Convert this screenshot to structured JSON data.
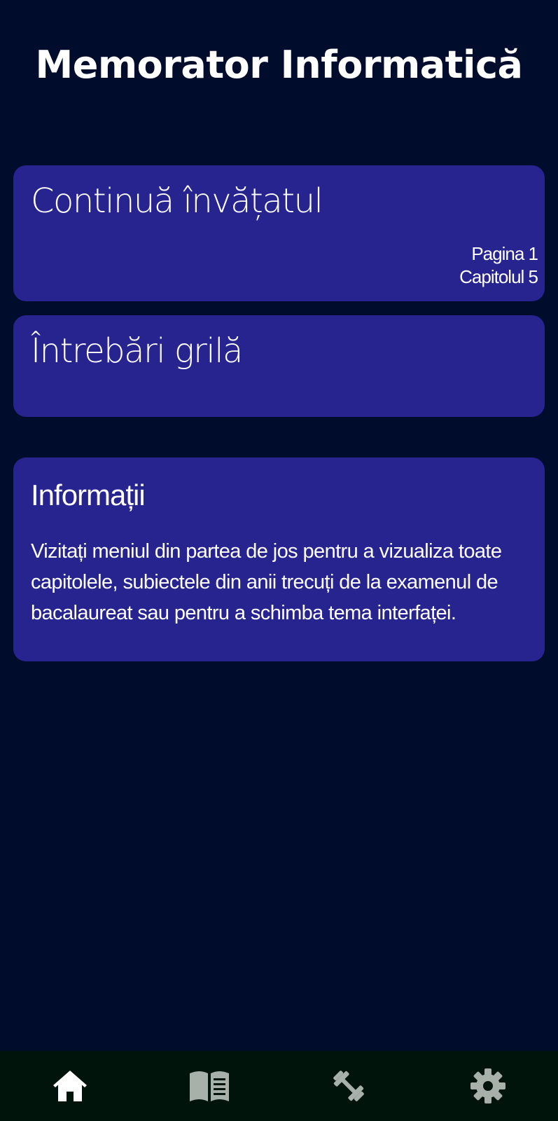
{
  "app": {
    "title": "Memorator Informatică"
  },
  "cards": {
    "continue": {
      "title": "Continuă învățatul",
      "page": "Pagina 1",
      "chapter": "Capitolul 5"
    },
    "quiz": {
      "title": "Întrebări grilă"
    },
    "info": {
      "title": "Informații",
      "text": "Vizitați meniul din partea de jos pentru a vizualiza toate capitolele, subiectele din anii trecuți de la examenul de bacalaureat sau pentru a schimba tema interfaței."
    }
  },
  "nav": {
    "items": [
      {
        "icon": "home-icon",
        "active": true
      },
      {
        "icon": "book-icon",
        "active": false
      },
      {
        "icon": "dumbbell-icon",
        "active": false
      },
      {
        "icon": "gear-icon",
        "active": false
      }
    ]
  },
  "colors": {
    "background": "#000c2c",
    "card": "#27248f",
    "nav_background": "#00140c",
    "nav_active": "#ffffff",
    "nav_inactive": "#a8b0aa"
  }
}
